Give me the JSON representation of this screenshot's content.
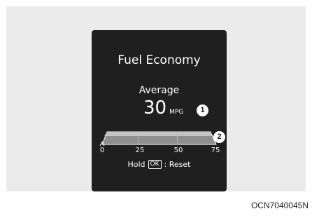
{
  "display": {
    "title": "Fuel Economy",
    "subtitle": "Average",
    "value": "30",
    "unit": "MPG",
    "gauge": {
      "ticks": [
        "0",
        "25",
        "50",
        "75"
      ],
      "level": 1.0
    },
    "hint": {
      "prefix": "Hold",
      "key": "OK",
      "suffix": ": Reset"
    }
  },
  "callouts": [
    "1",
    "2"
  ],
  "caption": "OCN7040045N"
}
